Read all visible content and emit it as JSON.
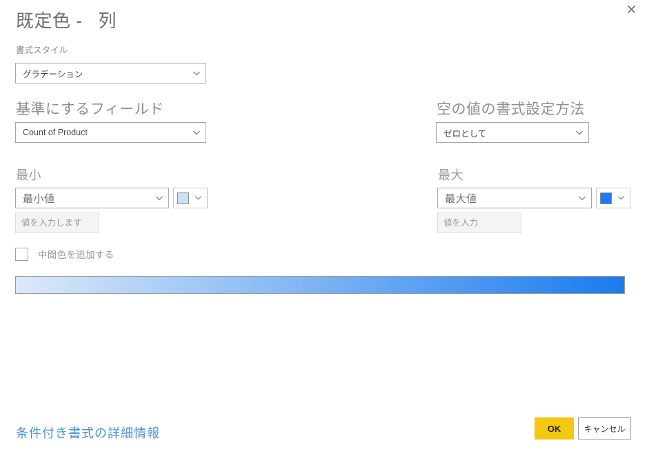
{
  "dialog": {
    "title": "既定色 -   列",
    "close_icon": "close-icon"
  },
  "format_style": {
    "label": "書式スタイル",
    "value": "グラデーション"
  },
  "base_field": {
    "heading": "基準にするフィールド",
    "value": "Count of Product"
  },
  "blank_values": {
    "heading": "空の値の書式設定方法",
    "value": "ゼロとして"
  },
  "minimum": {
    "label": "最小",
    "rule_value": "最小値",
    "input_placeholder": "値を入力します",
    "input_value": "",
    "color": "#cfdff2"
  },
  "maximum": {
    "label": "最大",
    "rule_value": "最大値",
    "input_placeholder": "値を入力",
    "input_value": "",
    "color": "#2079f0"
  },
  "middle_color": {
    "label": "中間色を追加する",
    "checked": false
  },
  "preview": {
    "from_color": "#dce9f8",
    "to_color": "#1a7bef"
  },
  "footer": {
    "help_link": "条件付き書式の詳細情報",
    "ok_label": "OK",
    "cancel_label": "キャンセル"
  },
  "theme": {
    "accent": "#f2c811",
    "link": "#4c93d3"
  }
}
